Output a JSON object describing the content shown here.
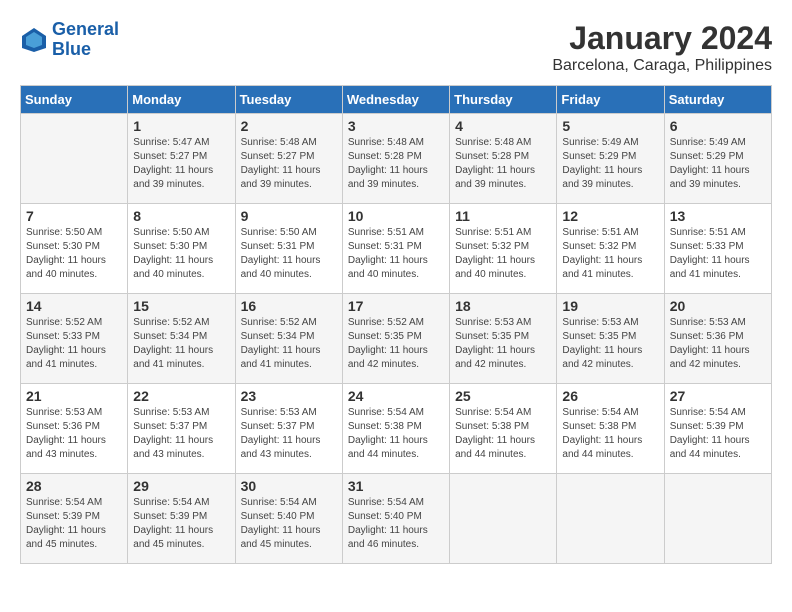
{
  "logo": {
    "text_general": "General",
    "text_blue": "Blue"
  },
  "title": "January 2024",
  "subtitle": "Barcelona, Caraga, Philippines",
  "weekdays": [
    "Sunday",
    "Monday",
    "Tuesday",
    "Wednesday",
    "Thursday",
    "Friday",
    "Saturday"
  ],
  "weeks": [
    [
      {
        "day": "",
        "info": ""
      },
      {
        "day": "1",
        "info": "Sunrise: 5:47 AM\nSunset: 5:27 PM\nDaylight: 11 hours\nand 39 minutes."
      },
      {
        "day": "2",
        "info": "Sunrise: 5:48 AM\nSunset: 5:27 PM\nDaylight: 11 hours\nand 39 minutes."
      },
      {
        "day": "3",
        "info": "Sunrise: 5:48 AM\nSunset: 5:28 PM\nDaylight: 11 hours\nand 39 minutes."
      },
      {
        "day": "4",
        "info": "Sunrise: 5:48 AM\nSunset: 5:28 PM\nDaylight: 11 hours\nand 39 minutes."
      },
      {
        "day": "5",
        "info": "Sunrise: 5:49 AM\nSunset: 5:29 PM\nDaylight: 11 hours\nand 39 minutes."
      },
      {
        "day": "6",
        "info": "Sunrise: 5:49 AM\nSunset: 5:29 PM\nDaylight: 11 hours\nand 39 minutes."
      }
    ],
    [
      {
        "day": "7",
        "info": "Sunrise: 5:50 AM\nSunset: 5:30 PM\nDaylight: 11 hours\nand 40 minutes."
      },
      {
        "day": "8",
        "info": "Sunrise: 5:50 AM\nSunset: 5:30 PM\nDaylight: 11 hours\nand 40 minutes."
      },
      {
        "day": "9",
        "info": "Sunrise: 5:50 AM\nSunset: 5:31 PM\nDaylight: 11 hours\nand 40 minutes."
      },
      {
        "day": "10",
        "info": "Sunrise: 5:51 AM\nSunset: 5:31 PM\nDaylight: 11 hours\nand 40 minutes."
      },
      {
        "day": "11",
        "info": "Sunrise: 5:51 AM\nSunset: 5:32 PM\nDaylight: 11 hours\nand 40 minutes."
      },
      {
        "day": "12",
        "info": "Sunrise: 5:51 AM\nSunset: 5:32 PM\nDaylight: 11 hours\nand 41 minutes."
      },
      {
        "day": "13",
        "info": "Sunrise: 5:51 AM\nSunset: 5:33 PM\nDaylight: 11 hours\nand 41 minutes."
      }
    ],
    [
      {
        "day": "14",
        "info": "Sunrise: 5:52 AM\nSunset: 5:33 PM\nDaylight: 11 hours\nand 41 minutes."
      },
      {
        "day": "15",
        "info": "Sunrise: 5:52 AM\nSunset: 5:34 PM\nDaylight: 11 hours\nand 41 minutes."
      },
      {
        "day": "16",
        "info": "Sunrise: 5:52 AM\nSunset: 5:34 PM\nDaylight: 11 hours\nand 41 minutes."
      },
      {
        "day": "17",
        "info": "Sunrise: 5:52 AM\nSunset: 5:35 PM\nDaylight: 11 hours\nand 42 minutes."
      },
      {
        "day": "18",
        "info": "Sunrise: 5:53 AM\nSunset: 5:35 PM\nDaylight: 11 hours\nand 42 minutes."
      },
      {
        "day": "19",
        "info": "Sunrise: 5:53 AM\nSunset: 5:35 PM\nDaylight: 11 hours\nand 42 minutes."
      },
      {
        "day": "20",
        "info": "Sunrise: 5:53 AM\nSunset: 5:36 PM\nDaylight: 11 hours\nand 42 minutes."
      }
    ],
    [
      {
        "day": "21",
        "info": "Sunrise: 5:53 AM\nSunset: 5:36 PM\nDaylight: 11 hours\nand 43 minutes."
      },
      {
        "day": "22",
        "info": "Sunrise: 5:53 AM\nSunset: 5:37 PM\nDaylight: 11 hours\nand 43 minutes."
      },
      {
        "day": "23",
        "info": "Sunrise: 5:53 AM\nSunset: 5:37 PM\nDaylight: 11 hours\nand 43 minutes."
      },
      {
        "day": "24",
        "info": "Sunrise: 5:54 AM\nSunset: 5:38 PM\nDaylight: 11 hours\nand 44 minutes."
      },
      {
        "day": "25",
        "info": "Sunrise: 5:54 AM\nSunset: 5:38 PM\nDaylight: 11 hours\nand 44 minutes."
      },
      {
        "day": "26",
        "info": "Sunrise: 5:54 AM\nSunset: 5:38 PM\nDaylight: 11 hours\nand 44 minutes."
      },
      {
        "day": "27",
        "info": "Sunrise: 5:54 AM\nSunset: 5:39 PM\nDaylight: 11 hours\nand 44 minutes."
      }
    ],
    [
      {
        "day": "28",
        "info": "Sunrise: 5:54 AM\nSunset: 5:39 PM\nDaylight: 11 hours\nand 45 minutes."
      },
      {
        "day": "29",
        "info": "Sunrise: 5:54 AM\nSunset: 5:39 PM\nDaylight: 11 hours\nand 45 minutes."
      },
      {
        "day": "30",
        "info": "Sunrise: 5:54 AM\nSunset: 5:40 PM\nDaylight: 11 hours\nand 45 minutes."
      },
      {
        "day": "31",
        "info": "Sunrise: 5:54 AM\nSunset: 5:40 PM\nDaylight: 11 hours\nand 46 minutes."
      },
      {
        "day": "",
        "info": ""
      },
      {
        "day": "",
        "info": ""
      },
      {
        "day": "",
        "info": ""
      }
    ]
  ]
}
